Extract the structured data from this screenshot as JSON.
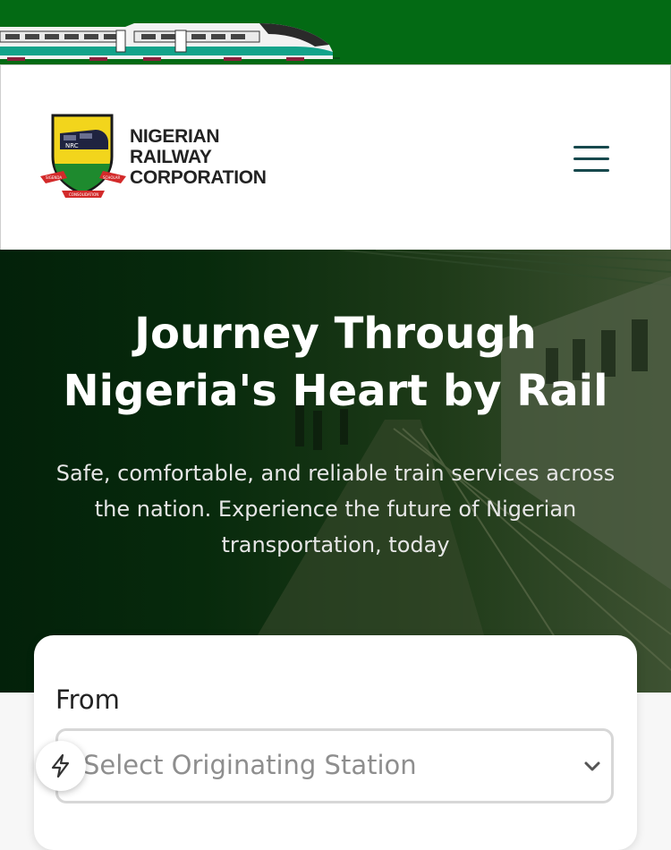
{
  "topbar": {
    "train_icon": "train-banner-icon"
  },
  "header": {
    "logo": {
      "lines": [
        "NIGERIAN",
        "RAILWAY",
        "CORPORATION"
      ],
      "emblem_text": "NRC",
      "ribbon_left": "SIGENDA",
      "ribbon_right": "SCHOLAR",
      "ribbon_bottom": "CONSOLIDATION"
    },
    "menu_icon": "hamburger-menu-icon"
  },
  "hero": {
    "title_line1": "Journey Through",
    "title_line2": "Nigeria's Heart by Rail",
    "subtitle": "Safe, comfortable, and reliable train services across the nation. Experience the future of Nigerian transportation, today"
  },
  "booking": {
    "from_label": "From",
    "from_placeholder": "Select Originating Station",
    "dropdown_icon": "chevron-down-icon"
  },
  "fab": {
    "icon": "lightning-icon"
  },
  "colors": {
    "brand_green": "#036a14",
    "menu_icon": "#17494d",
    "hero_bg": "#03210a"
  }
}
